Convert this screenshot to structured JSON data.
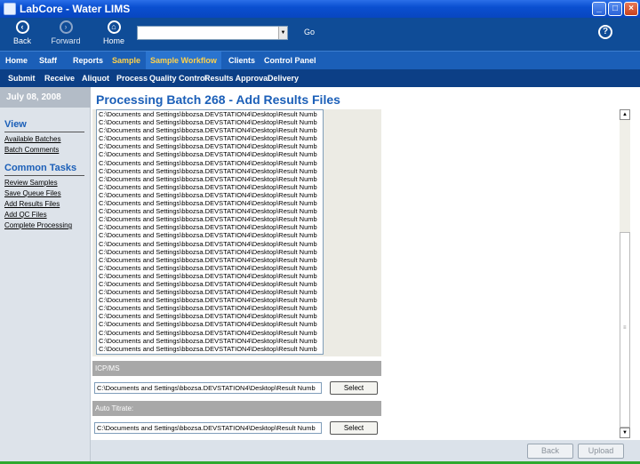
{
  "window": {
    "title": "LabCore - Water LIMS"
  },
  "toolbar": {
    "back": "Back",
    "forward": "Forward",
    "home": "Home",
    "address_value": "",
    "go": "Go",
    "help": "?"
  },
  "nav_main": [
    "Home",
    "Staff",
    "Reports",
    "Sample",
    "Sample Workflow",
    "Clients",
    "Control Panel"
  ],
  "nav_sub": [
    "Submit",
    "Receive",
    "Aliquot",
    "Process",
    "Quality Control",
    "Results Approval",
    "Delivery"
  ],
  "sidebar": {
    "date": "July 08, 2008",
    "view_heading": "View",
    "view_links": [
      "Available Batches",
      "Batch Comments"
    ],
    "tasks_heading": "Common Tasks",
    "task_links": [
      "Review Samples",
      "Save Queue Files",
      "Add Results Files",
      "Add QC Files",
      "Complete Processing"
    ]
  },
  "main": {
    "heading": "Processing Batch 268 - Add Results Files",
    "file_rows": [
      "C:\\Documents and Settings\\bbozsa.DEVSTATION4\\Desktop\\Result Numb",
      "C:\\Documents and Settings\\bbozsa.DEVSTATION4\\Desktop\\Result Numb",
      "C:\\Documents and Settings\\bbozsa.DEVSTATION4\\Desktop\\Result Numb",
      "C:\\Documents and Settings\\bbozsa.DEVSTATION4\\Desktop\\Result Numb",
      "C:\\Documents and Settings\\bbozsa.DEVSTATION4\\Desktop\\Result Numb",
      "C:\\Documents and Settings\\bbozsa.DEVSTATION4\\Desktop\\Result Numb",
      "C:\\Documents and Settings\\bbozsa.DEVSTATION4\\Desktop\\Result Numb",
      "C:\\Documents and Settings\\bbozsa.DEVSTATION4\\Desktop\\Result Numb",
      "C:\\Documents and Settings\\bbozsa.DEVSTATION4\\Desktop\\Result Numb",
      "C:\\Documents and Settings\\bbozsa.DEVSTATION4\\Desktop\\Result Numb",
      "C:\\Documents and Settings\\bbozsa.DEVSTATION4\\Desktop\\Result Numb",
      "C:\\Documents and Settings\\bbozsa.DEVSTATION4\\Desktop\\Result Numb",
      "C:\\Documents and Settings\\bbozsa.DEVSTATION4\\Desktop\\Result Numb",
      "C:\\Documents and Settings\\bbozsa.DEVSTATION4\\Desktop\\Result Numb",
      "C:\\Documents and Settings\\bbozsa.DEVSTATION4\\Desktop\\Result Numb",
      "C:\\Documents and Settings\\bbozsa.DEVSTATION4\\Desktop\\Result Numb",
      "C:\\Documents and Settings\\bbozsa.DEVSTATION4\\Desktop\\Result Numb",
      "C:\\Documents and Settings\\bbozsa.DEVSTATION4\\Desktop\\Result Numb",
      "C:\\Documents and Settings\\bbozsa.DEVSTATION4\\Desktop\\Result Numb",
      "C:\\Documents and Settings\\bbozsa.DEVSTATION4\\Desktop\\Result Numb",
      "C:\\Documents and Settings\\bbozsa.DEVSTATION4\\Desktop\\Result Numb",
      "C:\\Documents and Settings\\bbozsa.DEVSTATION4\\Desktop\\Result Numb",
      "C:\\Documents and Settings\\bbozsa.DEVSTATION4\\Desktop\\Result Numb",
      "C:\\Documents and Settings\\bbozsa.DEVSTATION4\\Desktop\\Result Numb",
      "C:\\Documents and Settings\\bbozsa.DEVSTATION4\\Desktop\\Result Numb",
      "C:\\Documents and Settings\\bbozsa.DEVSTATION4\\Desktop\\Result Numb",
      "C:\\Documents and Settings\\bbozsa.DEVSTATION4\\Desktop\\Result Numb",
      "C:\\Documents and Settings\\bbozsa.DEVSTATION4\\Desktop\\Result Numb",
      "C:\\Documents and Settings\\bbozsa.DEVSTATION4\\Desktop\\Result Numb",
      "C:\\Documents and Settings\\bbozsa.DEVSTATION4\\Desktop\\Result Numb"
    ],
    "icpms": {
      "label": "ICP/MS",
      "value": "C:\\Documents and Settings\\bbozsa.DEVSTATION4\\Desktop\\Result Numb",
      "button": "Select"
    },
    "auto_titrate": {
      "label": "Auto Titrate:",
      "value": "C:\\Documents and Settings\\bbozsa.DEVSTATION4\\Desktop\\Result Numb",
      "button": "Select"
    }
  },
  "footer": {
    "back": "Back",
    "upload": "Upload"
  },
  "colors": {
    "brand_blue": "#0f4c97",
    "nav_blue": "#1b5fb8",
    "highlight_yellow": "#ffd24a"
  }
}
